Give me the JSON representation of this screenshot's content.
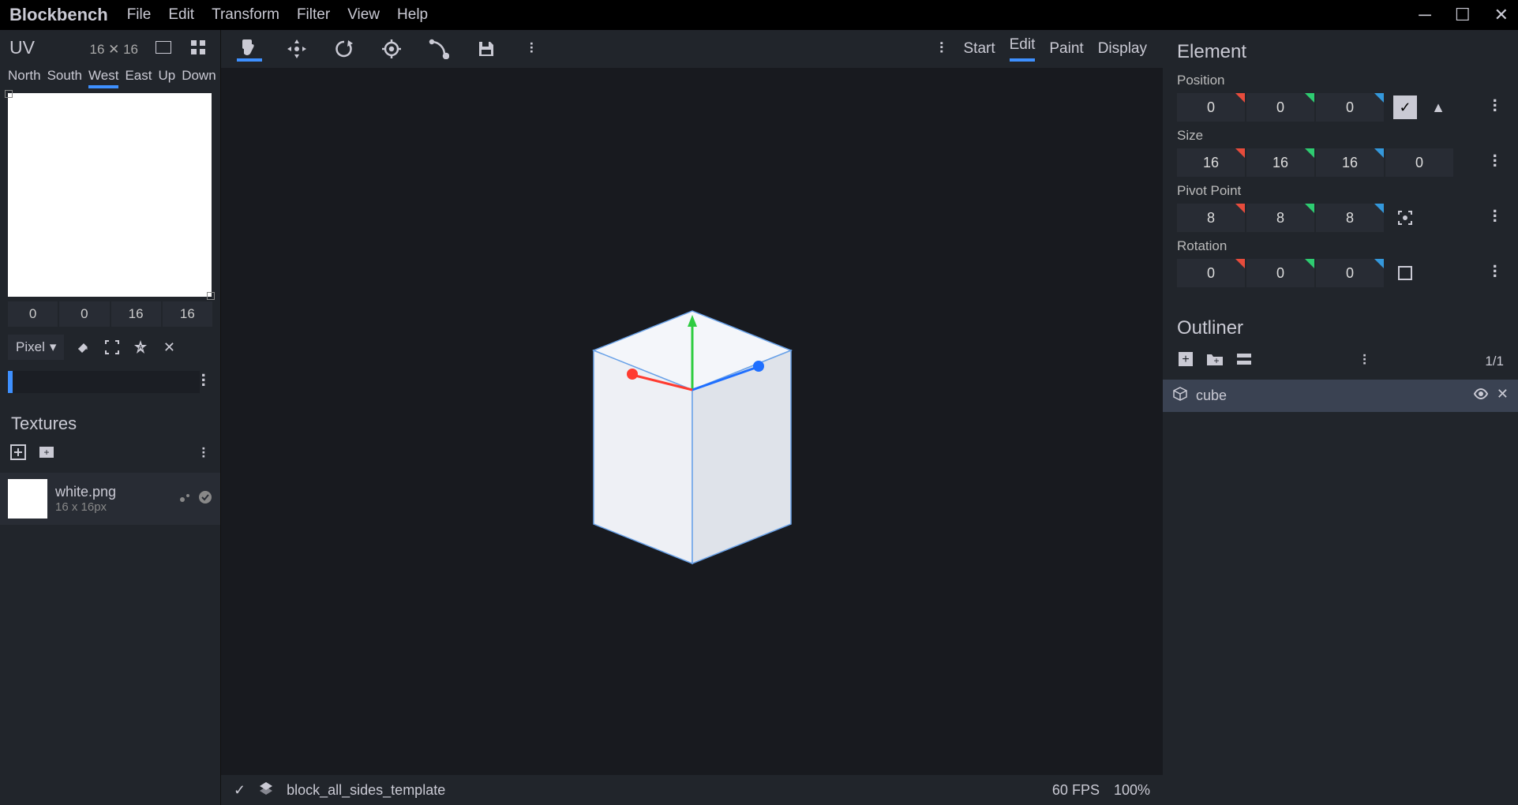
{
  "titlebar": {
    "brand": "Blockbench",
    "menus": [
      "File",
      "Edit",
      "Transform",
      "Filter",
      "View",
      "Help"
    ]
  },
  "modes": {
    "items": [
      "Start",
      "Edit",
      "Paint",
      "Display"
    ],
    "active": "Edit"
  },
  "uv": {
    "title": "UV",
    "size_label": "16 ✕ 16",
    "faces": [
      "North",
      "South",
      "West",
      "East",
      "Up",
      "Down"
    ],
    "active_face": "West",
    "coords": [
      "0",
      "0",
      "16",
      "16"
    ],
    "pixel_label": "Pixel"
  },
  "textures": {
    "title": "Textures",
    "items": [
      {
        "name": "white.png",
        "dim": "16 x 16px"
      }
    ]
  },
  "element": {
    "title": "Element",
    "position_label": "Position",
    "position": [
      "0",
      "0",
      "0"
    ],
    "size_label": "Size",
    "size": [
      "16",
      "16",
      "16",
      "0"
    ],
    "pivot_label": "Pivot Point",
    "pivot": [
      "8",
      "8",
      "8"
    ],
    "rotation_label": "Rotation",
    "rotation": [
      "0",
      "0",
      "0"
    ]
  },
  "outliner": {
    "title": "Outliner",
    "count": "1/1",
    "items": [
      {
        "name": "cube"
      }
    ]
  },
  "status": {
    "file": "block_all_sides_template",
    "fps": "60 FPS",
    "zoom": "100%"
  }
}
